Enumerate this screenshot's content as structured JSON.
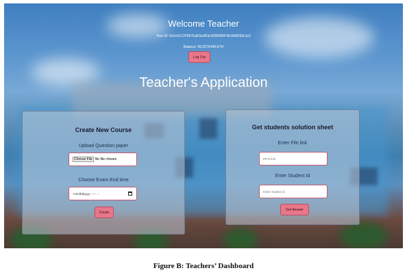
{
  "header": {
    "welcome": "Welcome Teacher",
    "user_id": "Your ID: 0x3c01C2F857EdE5a4E9c9289965F4b1968293c1e2",
    "balance": "Balance: 99.0270448 ETH",
    "logout_label": "Log Out"
  },
  "app_title": "Teacher's Application",
  "create_course": {
    "title": "Create New Course",
    "upload_label": "Upload Question paper",
    "choose_file_label": "Choose File",
    "no_file_text": "No file chosen",
    "exam_end_label": "Choose Exam End time",
    "date_placeholder": "mm/dd/yyyy, --:-- --",
    "create_label": "Create"
  },
  "solution_sheet": {
    "title": "Get students solution sheet",
    "file_link_label": "Enter File link",
    "file_link_placeholder": "IPFS link",
    "student_id_label": "Enter Student Id",
    "student_id_placeholder": "Enter student id",
    "answer_label": "Get Answer"
  },
  "caption": "Figure B: Teachers’ Dashboard",
  "colors": {
    "button_bg": "#e8778a",
    "input_border": "#c45a6e",
    "panel_bg": "rgba(190,200,215,0.55)"
  }
}
